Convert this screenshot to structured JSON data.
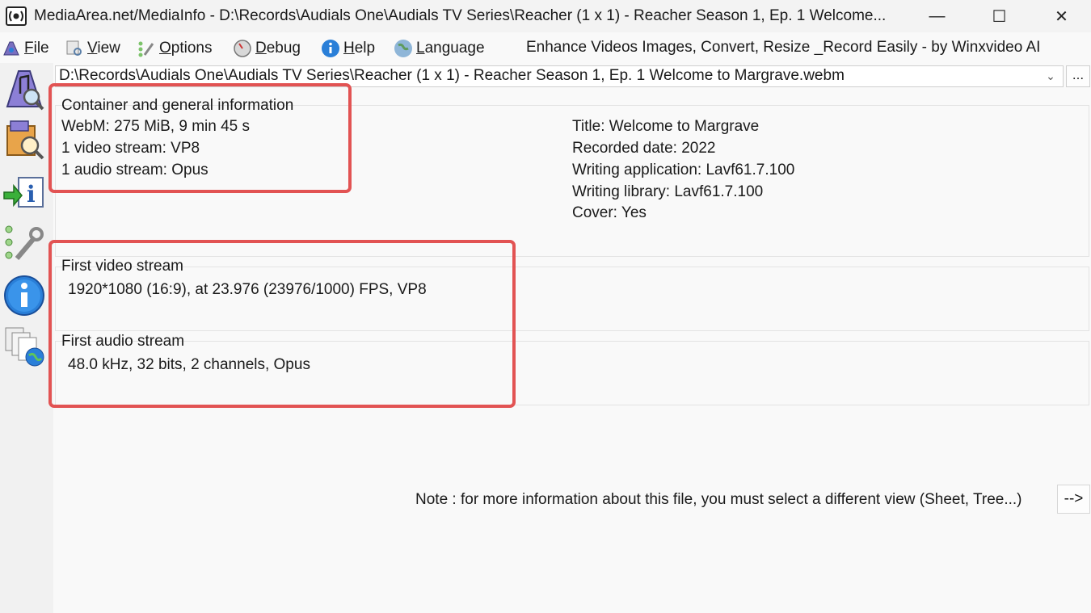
{
  "window": {
    "title": "MediaArea.net/MediaInfo - D:\\Records\\Audials One\\Audials TV Series\\Reacher (1 x 1) - Reacher Season 1, Ep. 1 Welcome...",
    "minimize": "—",
    "maximize": "☐",
    "close": "✕"
  },
  "menu": {
    "file": "File",
    "view": "View",
    "options": "Options",
    "debug": "Debug",
    "help": "Help",
    "language": "Language",
    "promo": "Enhance Videos  Images, Convert, Resize _Record Easily - by Winxvideo AI"
  },
  "path": {
    "value": "D:\\Records\\Audials One\\Audials TV Series\\Reacher (1 x 1) - Reacher Season 1, Ep. 1 Welcome to Margrave.webm",
    "browse": "..."
  },
  "general": {
    "header": "Container and general information",
    "lines": [
      "WebM: 275 MiB, 9 min 45 s",
      "1 video stream: VP8",
      "1 audio stream: Opus"
    ],
    "meta": [
      "Title: Welcome to Margrave",
      "Recorded date: 2022",
      "Writing application: Lavf61.7.100",
      "Writing library: Lavf61.7.100",
      "Cover: Yes"
    ]
  },
  "video": {
    "header": "First video stream",
    "detail": "1920*1080 (16:9), at 23.976 (23976/1000) FPS, VP8"
  },
  "audio": {
    "header": "First audio stream",
    "detail": "48.0 kHz, 32 bits, 2 channels, Opus"
  },
  "note": {
    "text": "Note : for more information about this file, you must select a different view (Sheet, Tree...)",
    "button": "-->"
  },
  "colors": {
    "highlight": "#e25353",
    "icon_blue": "#2a7fd8"
  }
}
